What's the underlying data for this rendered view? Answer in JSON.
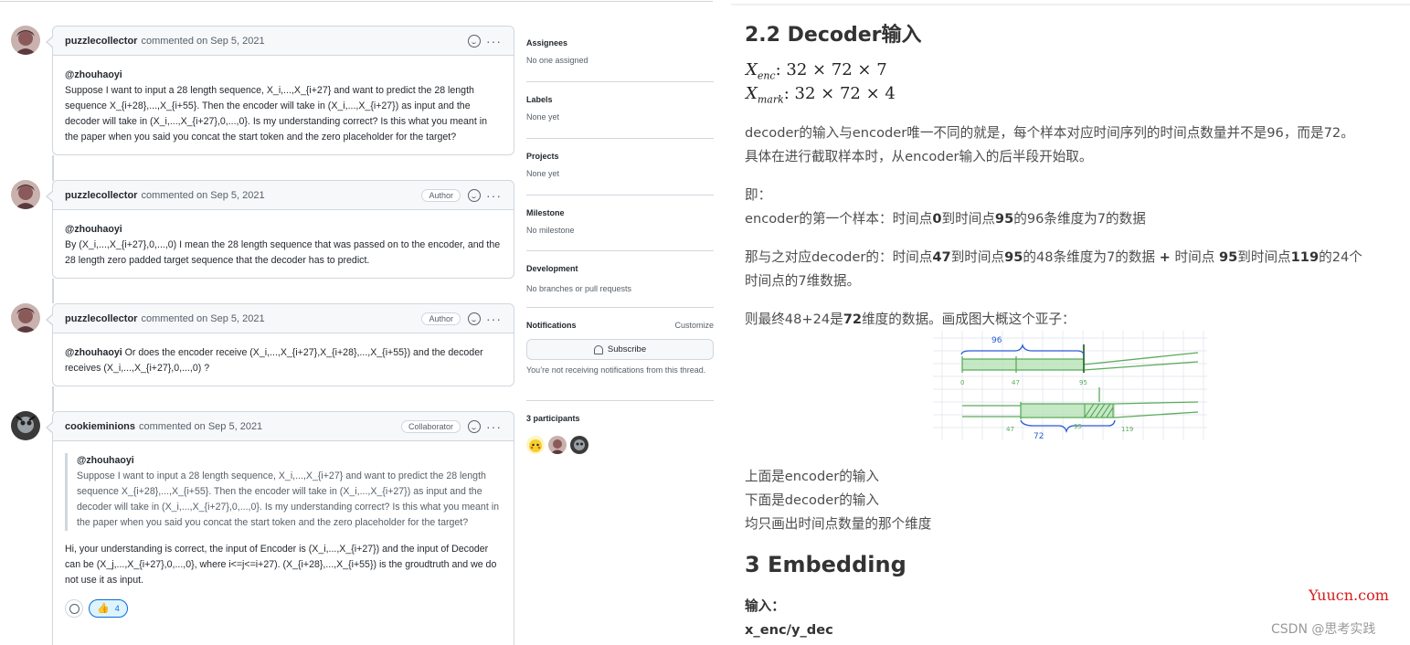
{
  "github": {
    "comments": [
      {
        "user": "puzzlecollector",
        "meta": "commented on Sep 5, 2021",
        "badge": "",
        "mention": "@zhouhaoyi",
        "text": "Suppose I want to input a 28 length sequence, X_i,...,X_{i+27} and want to predict the 28 length sequence X_{i+28},...,X_{i+55}. Then the encoder will take in (X_i,...,X_{i+27}) as input and the decoder will take in (X_i,...,X_{i+27},0,...,0}. Is my understanding correct? Is this what you meant in the paper when you said you concat the start token and the zero placeholder for the target?"
      },
      {
        "user": "puzzlecollector",
        "meta": "commented on Sep 5, 2021",
        "badge": "Author",
        "mention": "@zhouhaoyi",
        "text": "By (X_i,...,X_{i+27},0,...,0) I mean the 28 length sequence that was passed on to the encoder, and the 28 length zero padded target sequence that the decoder has to predict."
      },
      {
        "user": "puzzlecollector",
        "meta": "commented on Sep 5, 2021",
        "badge": "Author",
        "mention": "@zhouhaoyi",
        "text": " Or does the encoder receive (X_i,...,X_{i+27},X_{i+28},...,X_{i+55}) and the decoder receives (X_i,...,X_{i+27},0,...,0) ?"
      },
      {
        "user": "cookieminions",
        "meta": "commented on Sep 5, 2021",
        "badge": "Collaborator",
        "quote_mention": "@zhouhaoyi",
        "quote_text": "Suppose I want to input a 28 length sequence, X_i,...,X_{i+27} and want to predict the 28 length sequence X_{i+28},...,X_{i+55}. Then the encoder will take in (X_i,...,X_{i+27}) as input and the decoder will take in (X_i,...,X_{i+27},0,...,0}. Is my understanding correct? Is this what you meant in the paper when you said you concat the start token and the zero placeholder for the target?",
        "text": "Hi, your understanding is correct, the input of Encoder is (X_i,...,X_{i+27}) and the input of Decoder can be (X_j,...,X_{i+27},0,...,0}, where i<=j<=i+27). (X_{i+28},...,X_{i+55}) is the groudtruth and we do not use it as input.",
        "reaction_count": "4"
      }
    ],
    "sidebar": {
      "assignees_title": "Assignees",
      "assignees_value": "No one assigned",
      "labels_title": "Labels",
      "labels_value": "None yet",
      "projects_title": "Projects",
      "projects_value": "None yet",
      "milestone_title": "Milestone",
      "milestone_value": "No milestone",
      "development_title": "Development",
      "development_value": "No branches or pull requests",
      "notifications_title": "Notifications",
      "customize_label": "Customize",
      "subscribe_label": "Subscribe",
      "notification_note": "You’re not receiving notifications from this thread.",
      "participants_title": "3 participants"
    }
  },
  "article": {
    "heading_decoder": "2.2 Decoder输入",
    "math_enc_sub": "enc",
    "math_enc_rest": ": 32 × 72 × 7",
    "math_mark_sub": "mark",
    "math_mark_rest": ": 32 × 72 × 4",
    "para1_line1": "decoder的输入与encoder唯一不同的就是，每个样本对应时间序列的时间点数量并不是96，而是72。",
    "para1_line2": "具体在进行截取样本时，从encoder输入的后半段开始取。",
    "para2_line1": "即：",
    "para2_line2_a": "encoder的第一个样本：时间点",
    "para2_line2_b": "0",
    "para2_line2_c": "到时间点",
    "para2_line2_d": "95",
    "para2_line2_e": "的96条维度为7的数据",
    "para3_a": "那与之对应decoder的：时间点",
    "para3_b": "47",
    "para3_c": "到时间点",
    "para3_d": "95",
    "para3_e": "的48条维度为7的数据 ",
    "para3_f": "+",
    "para3_g": " 时间点 ",
    "para3_h": "95",
    "para3_i": "到时间点",
    "para3_j": "119",
    "para3_k": "的24个",
    "para3_line2": "时间点的7维数据。",
    "para4_a": "则最终48+24是",
    "para4_b": "72",
    "para4_c": "维度的数据。画成图大概这个亚子：",
    "sketch": {
      "label_96": "96",
      "label_0": "0",
      "label_47_top": "47",
      "label_95_top": "95",
      "label_47_bot": "47",
      "label_95_bot": "95",
      "label_119": "119",
      "label_72": "72"
    },
    "list_1": "上面是encoder的输入",
    "list_2": "下面是decoder的输入",
    "list_3": "均只画出时间点数量的那个维度",
    "heading_embedding": "3 Embedding",
    "input_label": "输入：",
    "input_value": "x_enc/y_dec",
    "watermark_site": "Yuucn.com",
    "watermark_csdn": "CSDN @思考实践"
  }
}
